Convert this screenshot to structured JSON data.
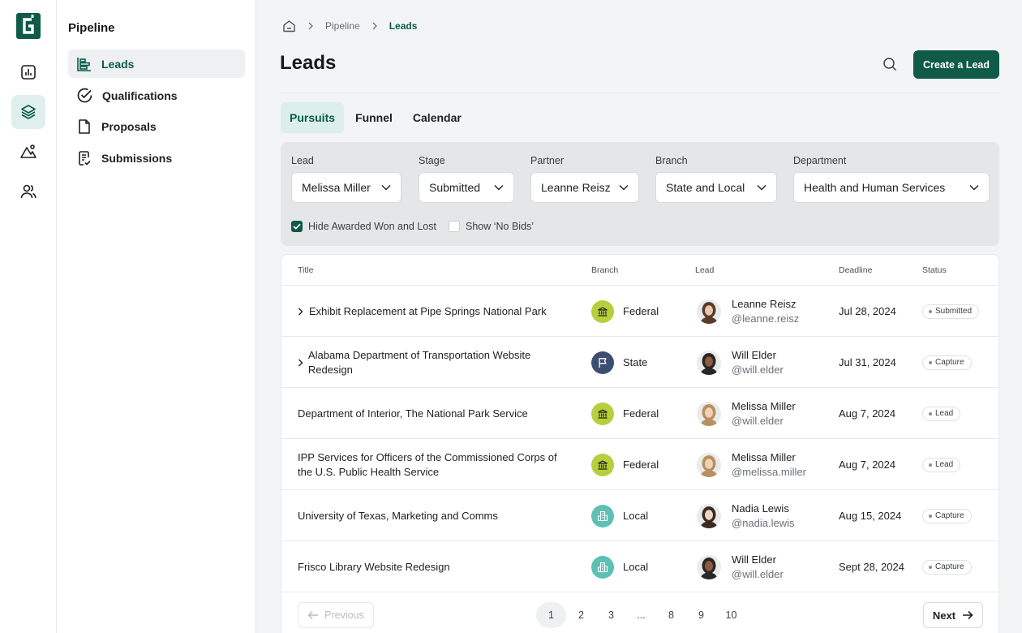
{
  "sidebar": {
    "title": "Pipeline",
    "items": [
      {
        "label": "Leads",
        "icon": "bar-chart-horizontal-icon",
        "active": true
      },
      {
        "label": "Qualifications",
        "icon": "check-circle-icon",
        "active": false
      },
      {
        "label": "Proposals",
        "icon": "file-icon",
        "active": false
      },
      {
        "label": "Submissions",
        "icon": "file-check-icon",
        "active": false
      }
    ]
  },
  "rail": {
    "items": [
      "analytics-icon",
      "layers-icon",
      "mountain-icon",
      "users-icon"
    ],
    "active": "layers-icon"
  },
  "breadcrumb": {
    "root_icon": "home-icon",
    "items": [
      "Pipeline",
      "Leads"
    ]
  },
  "header": {
    "title": "Leads",
    "create_label": "Create a Lead"
  },
  "tabs": [
    {
      "label": "Pursuits",
      "active": true
    },
    {
      "label": "Funnel",
      "active": false
    },
    {
      "label": "Calendar",
      "active": false
    }
  ],
  "filters": [
    {
      "label": "Lead",
      "value": "Melissa Miller"
    },
    {
      "label": "Stage",
      "value": "Submitted"
    },
    {
      "label": "Partner",
      "value": "Leanne Reisz"
    },
    {
      "label": "Branch",
      "value": "State and Local"
    },
    {
      "label": "Department",
      "value": "Health and Human Services"
    }
  ],
  "checkboxes": [
    {
      "label": "Hide Awarded Won and Lost",
      "checked": true
    },
    {
      "label": "Show ‘No Bids’",
      "checked": false
    }
  ],
  "table": {
    "columns": [
      "Title",
      "Branch",
      "Lead",
      "Deadline",
      "Status"
    ],
    "rows": [
      {
        "title": "Exhibit Replacement at Pipe Springs National Park",
        "expandable": true,
        "branch": "Federal",
        "branch_icon": "bank-icon",
        "lead_name": "Leanne Reisz",
        "lead_handle": "@leanne.reisz",
        "deadline": "Jul 28, 2024",
        "status": "Submitted"
      },
      {
        "title": "Alabama Department of Transportation Website Redesign",
        "expandable": true,
        "branch": "State",
        "branch_icon": "flag-icon",
        "lead_name": "Will Elder",
        "lead_handle": "@will.elder",
        "deadline": "Jul 31, 2024",
        "status": "Capture"
      },
      {
        "title": "Department of Interior, The National Park Service",
        "expandable": false,
        "branch": "Federal",
        "branch_icon": "bank-icon",
        "lead_name": "Melissa Miller",
        "lead_handle": "@will.elder",
        "deadline": "Aug 7, 2024",
        "status": "Lead"
      },
      {
        "title": "IPP Services for Officers of the Commissioned Corps of the U.S. Public Health Service",
        "expandable": false,
        "branch": "Federal",
        "branch_icon": "bank-icon",
        "lead_name": "Melissa Miller",
        "lead_handle": "@melissa.miller",
        "deadline": "Aug 7, 2024",
        "status": "Lead"
      },
      {
        "title": "University of Texas, Marketing and Comms",
        "expandable": false,
        "branch": "Local",
        "branch_icon": "building-icon",
        "lead_name": "Nadia Lewis",
        "lead_handle": "@nadia.lewis",
        "deadline": "Aug 15, 2024",
        "status": "Capture"
      },
      {
        "title": "Frisco Library Website Redesign",
        "expandable": false,
        "branch": "Local",
        "branch_icon": "building-icon",
        "lead_name": "Will Elder",
        "lead_handle": "@will.elder",
        "deadline": "Sept 28, 2024",
        "status": "Capture"
      }
    ]
  },
  "pagination": {
    "previous_label": "Previous",
    "next_label": "Next",
    "pages": [
      "1",
      "2",
      "3",
      "...",
      "8",
      "9",
      "10"
    ],
    "current": "1"
  },
  "colors": {
    "brand": "#0f5a48",
    "federal": "#b7cf3c",
    "state": "#3b4e6e",
    "local": "#5cc0b4"
  }
}
